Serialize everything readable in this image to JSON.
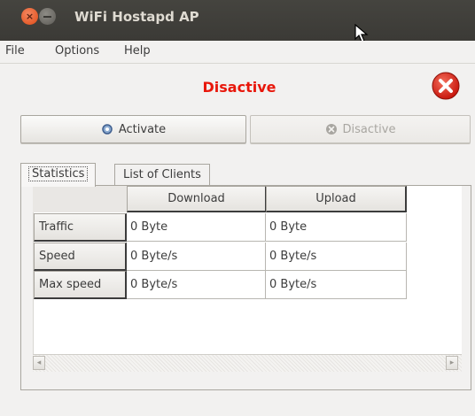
{
  "window": {
    "title": "WiFi Hostapd AP",
    "close_glyph": "×"
  },
  "menu": [
    "File",
    "Options",
    "Help"
  ],
  "status": {
    "text": "Disactive",
    "color": "#e8170b",
    "icon": "red-circle-x-icon"
  },
  "buttons": {
    "activate_label": "Activate",
    "activate_icon": "gear-icon",
    "disactive_label": "Disactive",
    "disactive_icon": "circle-x-icon",
    "disactive_enabled": false
  },
  "tabs": [
    {
      "label": "Statistics",
      "active": true
    },
    {
      "label": "List of Clients",
      "active": false
    }
  ],
  "table": {
    "columns": [
      "Download",
      "Upload"
    ],
    "rows": [
      {
        "label": "Traffic",
        "download": "0 Byte",
        "upload": "0 Byte"
      },
      {
        "label": "Speed",
        "download": "0 Byte/s",
        "upload": "0 Byte/s"
      },
      {
        "label": "Max speed",
        "download": "0 Byte/s",
        "upload": "0 Byte/s"
      }
    ]
  },
  "scrollbar": {
    "left_glyph": "◂",
    "right_glyph": "▸"
  }
}
